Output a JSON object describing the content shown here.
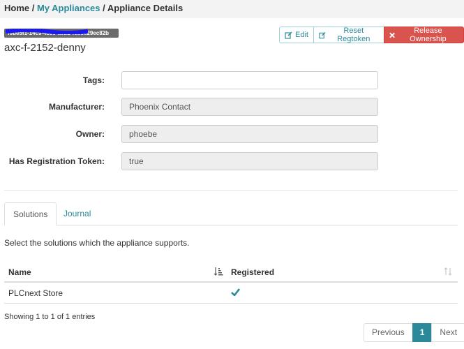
{
  "breadcrumb": {
    "home": "Home",
    "sep1": " / ",
    "my_appliances": "My Appliances",
    "sep2": " / ",
    "current": "Appliance Details"
  },
  "appliance": {
    "id_badge": "f0be5f1-14c9-4859-a0b2-fcb8e29ec82b",
    "name": "axc-f-2152-denny"
  },
  "actions": {
    "edit": "Edit",
    "reset_regtoken": "Reset Regtoken",
    "release_ownership": "Release Ownership"
  },
  "form": {
    "tags": {
      "label": "Tags:",
      "value": ""
    },
    "manufacturer": {
      "label": "Manufacturer:",
      "value": "Phoenix Contact"
    },
    "owner": {
      "label": "Owner:",
      "value": "phoebe"
    },
    "has_token": {
      "label": "Has Registration Token:",
      "value": "true"
    }
  },
  "tabs": [
    {
      "label": "Solutions",
      "active": true
    },
    {
      "label": "Journal",
      "active": false
    }
  ],
  "solutions": {
    "description": "Select the solutions which the appliance supports.",
    "columns": [
      "Name",
      "Registered"
    ],
    "rows": [
      {
        "name": "PLCnext Store",
        "registered": true
      }
    ],
    "info": "Showing 1 to 1 of 1 entries"
  },
  "pagination": {
    "previous": "Previous",
    "current": "1",
    "next": "Next"
  },
  "colors": {
    "accent": "#2a8a9a",
    "danger": "#d9534f",
    "redaction": "#1b1bf0"
  }
}
